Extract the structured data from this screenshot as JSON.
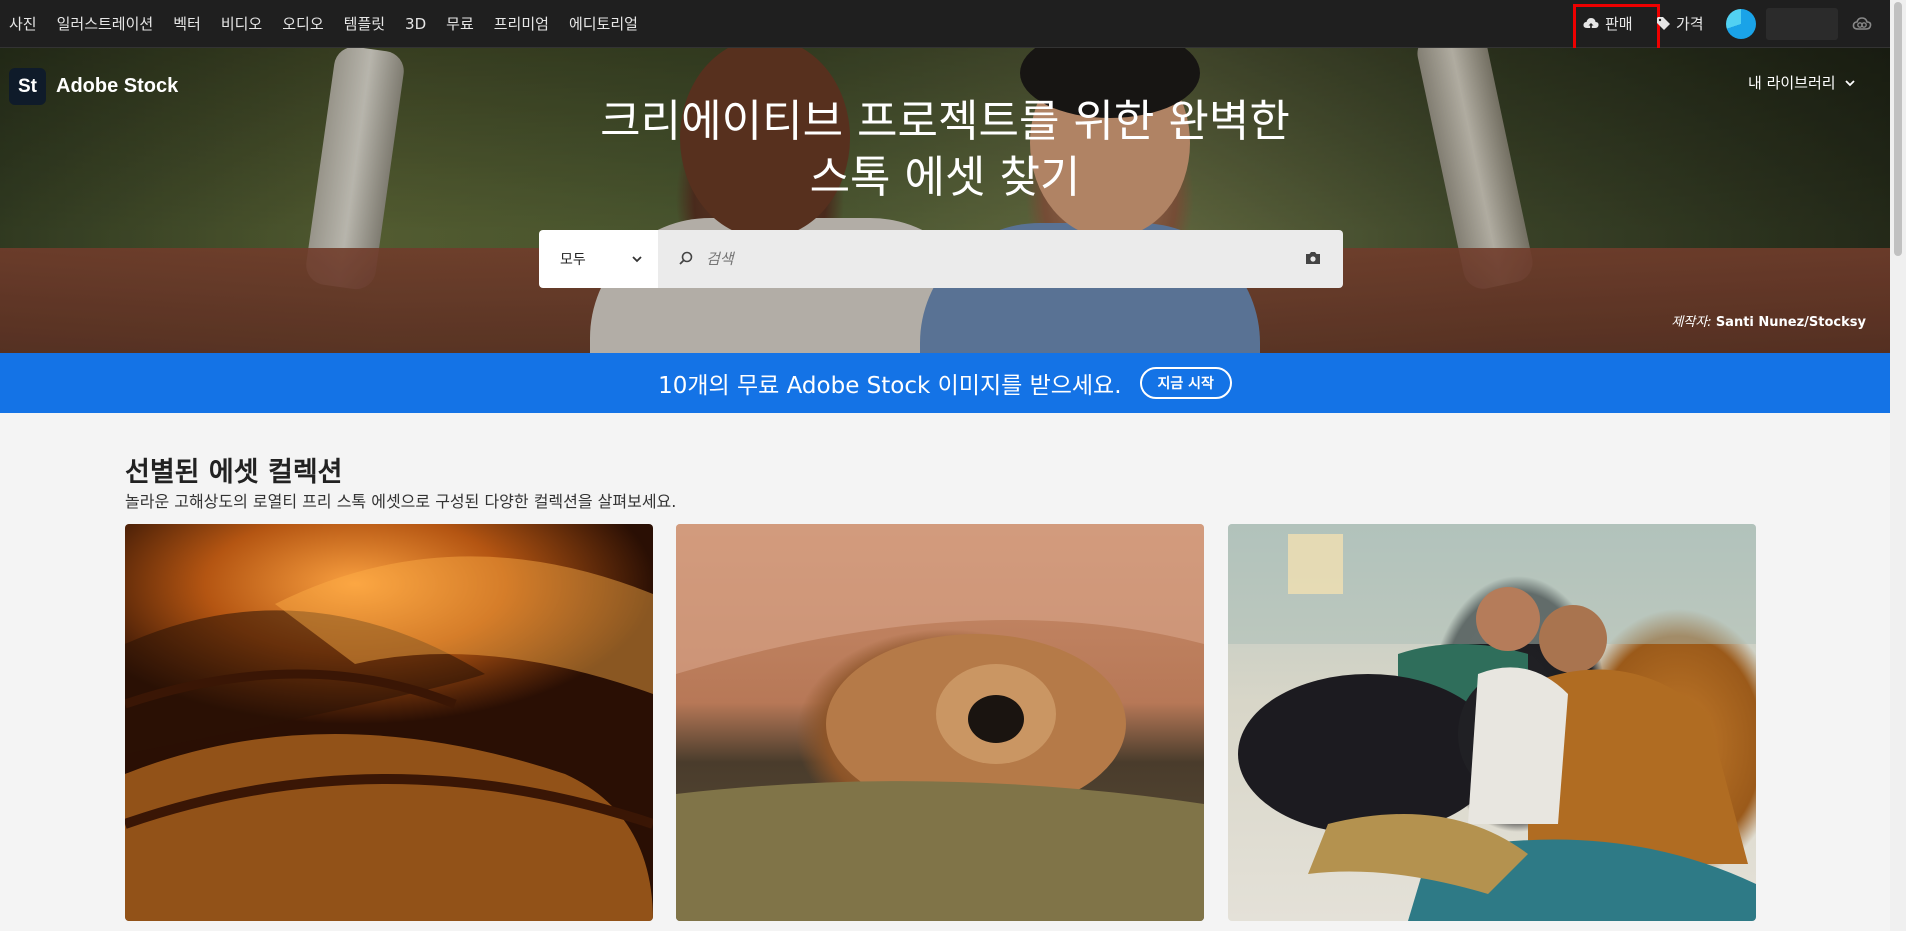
{
  "topnav": {
    "items": [
      "사진",
      "일러스트레이션",
      "벡터",
      "비디오",
      "오디오",
      "템플릿",
      "3D",
      "무료",
      "프리미엄",
      "에디토리얼"
    ],
    "sell_label": "판매",
    "price_label": "가격"
  },
  "hero": {
    "brand": "Adobe Stock",
    "brand_mark": "St",
    "my_library": "내 라이브러리",
    "headline_line1": "크리에이티브 프로젝트를 위한 완벽한",
    "headline_line2": "스톡 에셋 찾기",
    "search": {
      "category": "모두",
      "placeholder": "검색"
    },
    "credit_prefix": "제작자:",
    "credit_name": "Santi Nunez/Stocksy"
  },
  "promo": {
    "text": "10개의 무료 Adobe Stock 이미지를 받으세요.",
    "button": "지금 시작"
  },
  "collections": {
    "title": "선별된 에셋 컬렉션",
    "subtitle": "놀라운 고해상도의 로열티 프리 스톡 에셋으로 구성된 다양한 컬렉션을 살펴보세요."
  },
  "colors": {
    "nav_bg": "#1f1f1f",
    "promo_bg": "#1473e6",
    "highlight": "#ee0000"
  }
}
